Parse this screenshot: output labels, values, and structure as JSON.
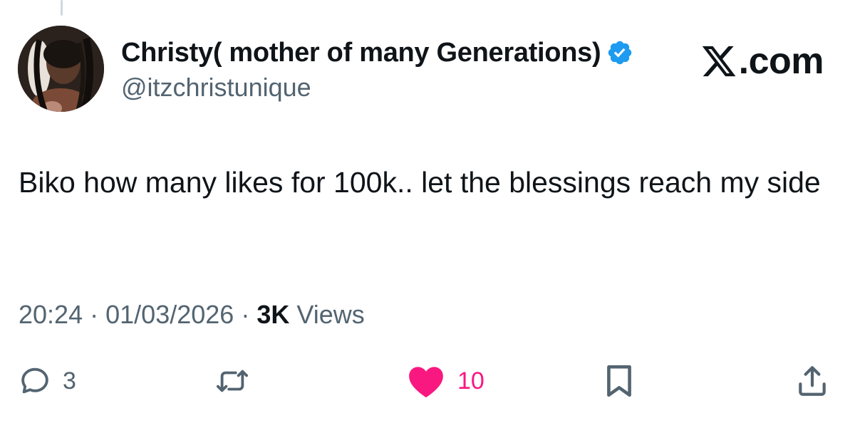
{
  "author": {
    "display_name": "Christy( mother of many Generations)",
    "handle": "@itzchristunique",
    "avatar_icon": "avatar",
    "verified_icon": "verified-badge-icon"
  },
  "brand": {
    "label": ".com",
    "icon": "x-logo-icon"
  },
  "tweet": {
    "text": "Biko how many likes for 100k.. let the blessings reach my side"
  },
  "meta": {
    "time": "20:24",
    "separator": "·",
    "date": "01/03/2026",
    "views_count": "3K",
    "views_label": "Views"
  },
  "actions": {
    "reply": {
      "icon": "reply-icon",
      "count": "3"
    },
    "repost": {
      "icon": "repost-icon"
    },
    "like": {
      "icon": "heart-icon",
      "count": "10",
      "color": "#f91880"
    },
    "bookmark": {
      "icon": "bookmark-icon"
    },
    "share": {
      "icon": "share-icon"
    }
  },
  "colors": {
    "text_primary": "#0f1419",
    "text_secondary": "#536471",
    "verified_blue": "#1d9bf0",
    "like_pink": "#f91880",
    "thread_line": "#cfd9de"
  }
}
